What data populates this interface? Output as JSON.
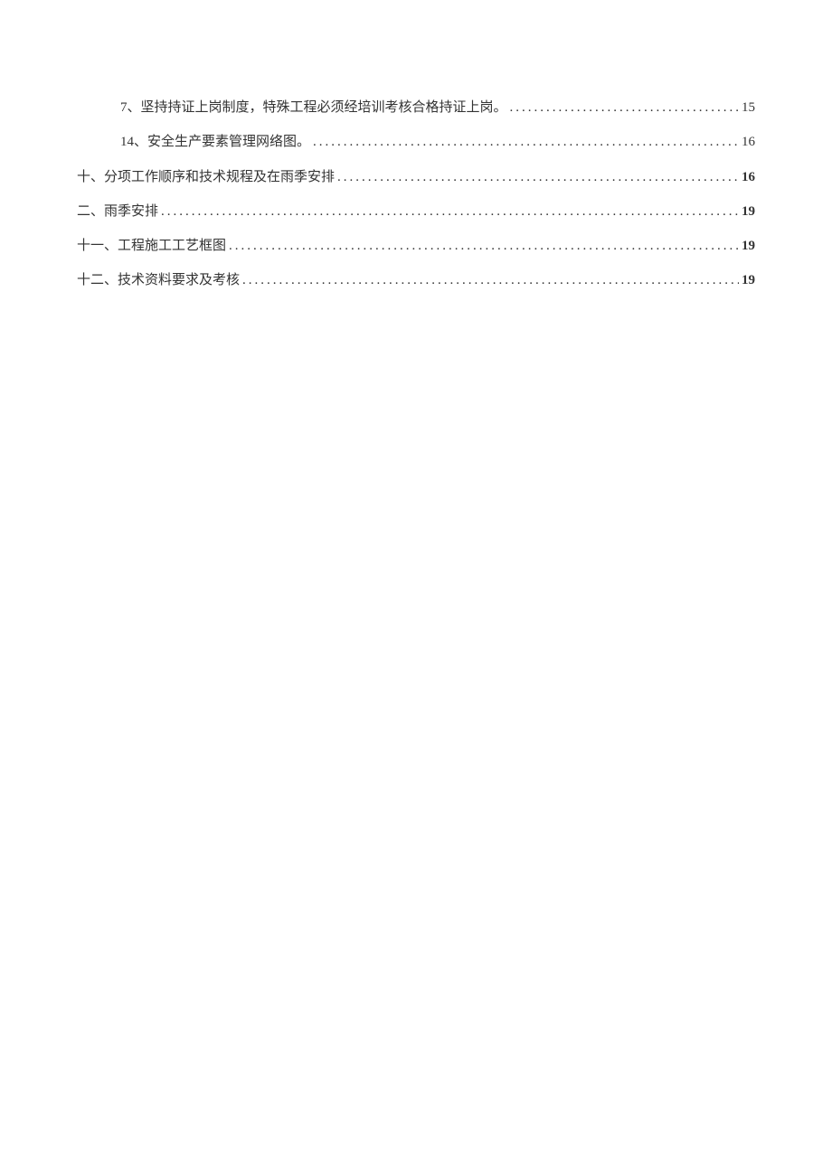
{
  "toc": {
    "entries": [
      {
        "text": "7、坚持持证上岗制度，特殊工程必须经培训考核合格持证上岗。",
        "page": "15",
        "indent": 1,
        "boldPage": false
      },
      {
        "text": "14、安全生产要素管理网络图。",
        "page": "16",
        "indent": 1,
        "boldPage": false
      },
      {
        "text": "十、分项工作顺序和技术规程及在雨季安排",
        "page": "16",
        "indent": 0,
        "boldPage": true
      },
      {
        "text": "二、雨季安排",
        "page": "19",
        "indent": 0,
        "boldPage": true
      },
      {
        "text": "十一、工程施工工艺框图",
        "page": "19",
        "indent": 0,
        "boldPage": true
      },
      {
        "text": "十二、技术资料要求及考核",
        "page": "19",
        "indent": 0,
        "boldPage": true
      }
    ]
  }
}
